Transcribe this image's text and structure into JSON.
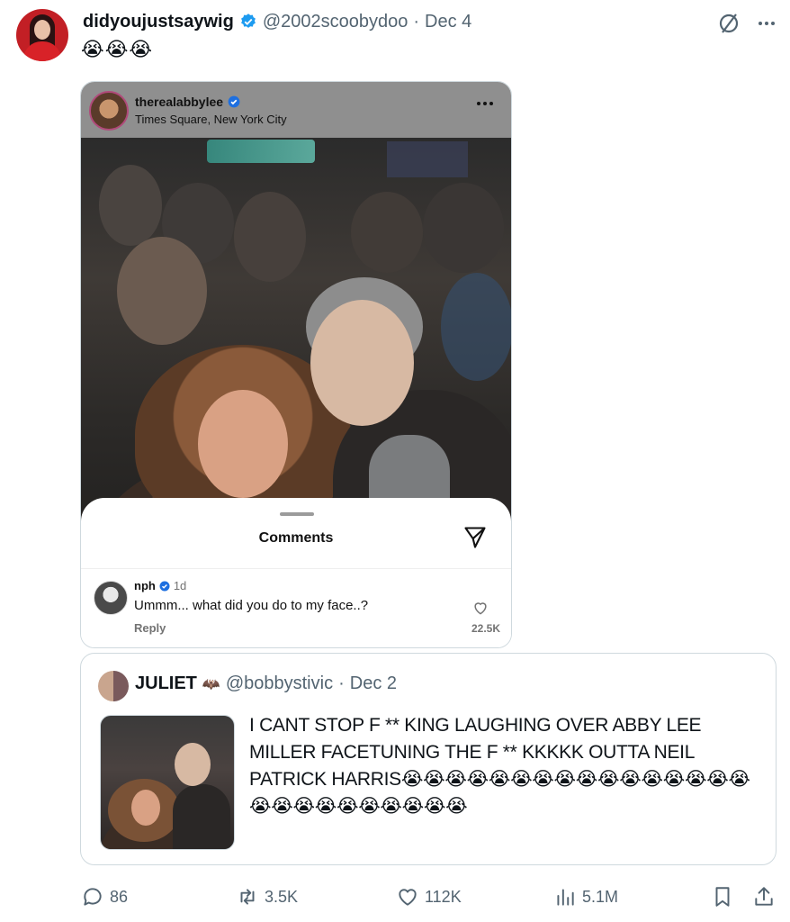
{
  "tweet": {
    "display_name": "didyoujustsaywig",
    "handle": "@2002scoobydoo",
    "separator": "·",
    "date": "Dec 4",
    "text": "😭😭😭"
  },
  "instagram": {
    "username": "therealabbylee",
    "location": "Times Square, New York City",
    "comments_title": "Comments",
    "comment": {
      "username": "nph",
      "time": "1d",
      "text": "Ummm... what did you do to my face..?",
      "reply_label": "Reply",
      "likes": "22.5K"
    }
  },
  "quote": {
    "display_name": "JULIET",
    "name_emoji": "🦇",
    "handle": "@bobbystivic",
    "separator": "·",
    "date": "Dec 2",
    "text": "I CANT STOP F ** KING LAUGHING OVER ABBY LEE MILLER FACETUNING THE F ** KKKKK OUTTA NEIL PATRICK HARRIS😭😭😭😭😭😭😭😭😭😭😭😭😭😭😭😭😭😭😭😭😭😭😭😭😭😭"
  },
  "actions": {
    "replies": "86",
    "reposts": "3.5K",
    "likes": "112K",
    "views": "5.1M"
  },
  "colors": {
    "verified_blue": "#1d9bf0",
    "secondary_text": "#536471",
    "border": "#cfd9de"
  },
  "icons": [
    "grok-icon",
    "more-icon",
    "verified-icon",
    "send-icon",
    "heart-icon",
    "reply-icon",
    "retweet-icon",
    "like-icon",
    "views-icon",
    "bookmark-icon",
    "share-icon"
  ]
}
